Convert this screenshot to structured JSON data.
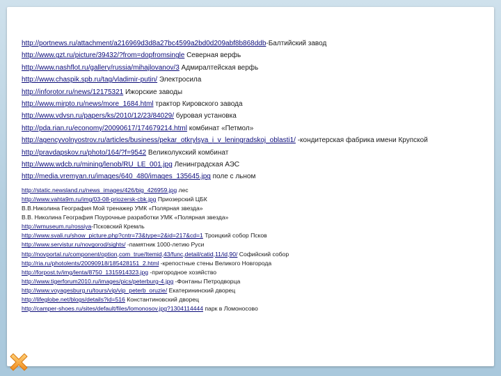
{
  "slide": {
    "rows": [
      {
        "url": "http://portnews.ru/attachment/a216969d3d8a27bc4599a2bd0d209abf8b868ddb",
        "text": "-Балтийский завод"
      },
      {
        "url": "http://www.gzt.ru/picture/39432/?from=dopfromsingle",
        "text": " Северная верфь"
      },
      {
        "url": "http://www.nashflot.ru/gallery/russia/mihajlovanov/3",
        "text": " Адмиралтейская верфь"
      },
      {
        "url": "http://www.chaspik.spb.ru/tag/vladimir-putin/",
        "text": " Электросила"
      },
      {
        "url": "http://inforotor.ru/news/12175321",
        "text": " Ижорские заводы"
      },
      {
        "url": "http://www.mirpto.ru/news/more_1684.html",
        "text": " трактор Кировского завода"
      },
      {
        "url": "http://www.vdvsn.ru/papers/ks/2010/12/23/84029/",
        "text": " буровая установка"
      },
      {
        "url": "http://pda.rian.ru/economy/20090617/174679214.html",
        "text": " комбинат «Петмол»"
      },
      {
        "url": "http://agencyvolnyostrov.ru/articles/business/pekar_otkrylsya_i_v_leningradskoj_oblasti1/",
        "text": " -кондитерская фабрика имени Крупской"
      },
      {
        "url": "http://pravdapskov.ru/photo/164/?f=9542",
        "text": " Великолукский комбинат"
      },
      {
        "url": "http://www.wdcb.ru/mining/lenob/RU_LE_001.jpg",
        "text": " Ленинградская АЭС"
      },
      {
        "url": "http://media.vremyan.ru/images/640_480/images_135645.jpg",
        "text": " поле с льном"
      },
      {
        "url": "http://static.newsland.ru/news_images/426/big_426959.jpg",
        "text": " лес"
      },
      {
        "url": "http://www.vahta9m.ru/img/03-08-priozersk-cbk.jpg",
        "text": " Приозерский ЦБК"
      },
      {
        "url": "",
        "text": "В.В.Николина География Мой тренажер УМК «Полярная звезда»"
      },
      {
        "url": "",
        "text": "В.В. Николина  География Поурочные разработки УМК «Полярная звезда»"
      },
      {
        "url": "http://wmuseum.ru/rossiya",
        "text": "-Псковский Кремль"
      },
      {
        "url": "http://www.svali.ru/show_picture.php?cntr=73&type=2&id=217&cd=1",
        "text": " Троицкий собор Псков"
      },
      {
        "url": "http://www.servistur.ru/novgorod/sights/",
        "text": " -памятник 1000-летию Руси"
      },
      {
        "url": "http://novportal.ru/component/option,com_true/Itemid,43/func,detail/catid,11/id,90/",
        "text": " Софийский собор"
      },
      {
        "url": "http://ria.ru/photolents/20090918/185428151_2.html",
        "text": " -крепостные стены Великого Новгорода"
      },
      {
        "url": "http://forpost.tv/img/lenta/8750_1315914323.jpg",
        "text": " -пригородное хозяйство"
      },
      {
        "url": "http://www.tigerforum2010.ru/images/pics/peterburg-4.jpg",
        "text": " -Фонтаны Петродворца"
      },
      {
        "url": "http://www.voyagesburg.ru/tours/vip/vip_peterb_oruzie/",
        "text": " Екатерининский дворец"
      },
      {
        "url": "http://lifeglobe.net/blogs/details?id=516",
        "text": " Константиновский дворец"
      },
      {
        "url": "http://camper-shoes.ru/sites/default/files/lomonosov.jpg?1304114444",
        "text": " парк в Ломоносово"
      }
    ]
  },
  "icons": {
    "deco": "x-cross-icon"
  },
  "colors": {
    "link": "#0b0b7a",
    "deco_icon": "#f5a623"
  }
}
